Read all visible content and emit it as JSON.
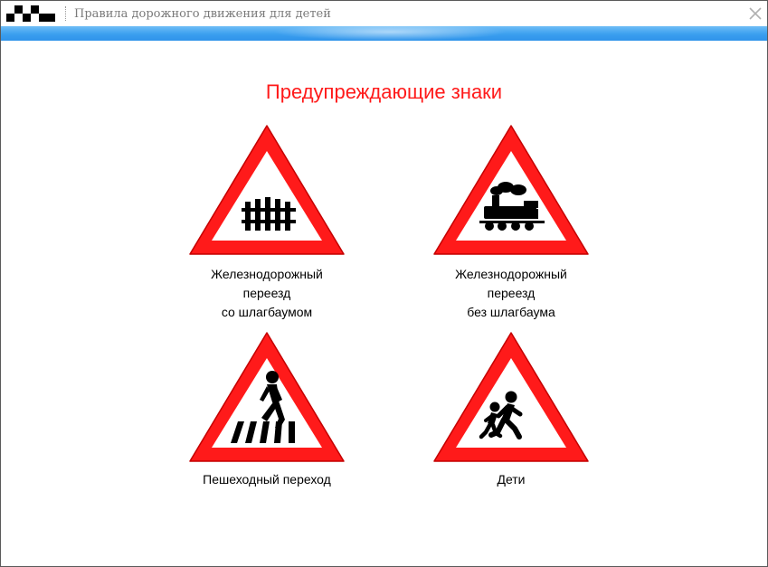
{
  "window": {
    "title": "Правила дорожного движения для детей",
    "icons": {
      "logo": "checkered-flag-icon",
      "close": "close-icon"
    },
    "colors": {
      "accent_bar": "#3b9fef",
      "heading": "#ff1a1a",
      "sign_border": "#ff1a1a"
    }
  },
  "page": {
    "heading": "Предупреждающие знаки",
    "signs": [
      {
        "icon": "railway-crossing-barrier-icon",
        "caption": [
          "Железнодорожный",
          "переезд",
          "со шлагбаумом"
        ]
      },
      {
        "icon": "railway-crossing-locomotive-icon",
        "caption": [
          "Железнодорожный",
          "переезд",
          "без шлагбаума"
        ]
      },
      {
        "icon": "pedestrian-crossing-icon",
        "caption": [
          "Пешеходный переход"
        ]
      },
      {
        "icon": "children-icon",
        "caption": [
          "Дети"
        ]
      }
    ]
  }
}
